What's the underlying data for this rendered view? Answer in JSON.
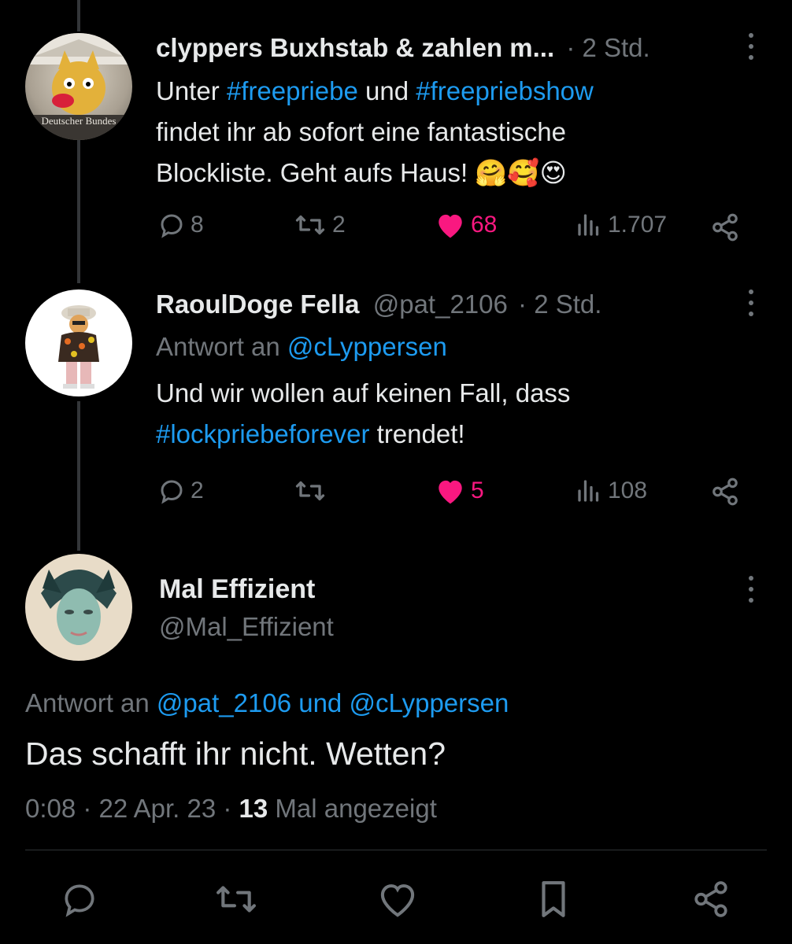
{
  "tweet1": {
    "display_name": "clyppers Buxhstab & zahlen m...",
    "time": "· 2 Std.",
    "text_line1_pre": "Unter ",
    "hashtag1": "#freepriebe",
    "text_line1_mid": " und ",
    "hashtag2": "#freepriebshow",
    "text_line2": "findet ihr ab sofort eine fantastische",
    "text_line3": "Blockliste. Geht aufs Haus! 🤗🥰😍",
    "avatar_caption": "Deutscher Bundes",
    "replies": "8",
    "retweets": "2",
    "likes": "68",
    "views": "1.707"
  },
  "tweet2": {
    "display_name": "RaoulDoge Fella",
    "handle": "@pat_2106",
    "time": "· 2 Std.",
    "reply_to_label": "Antwort an ",
    "reply_to_handle": "@cLyppersen",
    "text_line1": "Und wir wollen auf keinen Fall, dass",
    "hashtag": "#lockpriebeforever",
    "text_line2_post": " trendet!",
    "replies": "2",
    "retweets": "",
    "likes": "5",
    "views": "108"
  },
  "main_tweet": {
    "display_name": "Mal Effizient",
    "handle": "@Mal_Effizient",
    "reply_to_label": "Antwort an ",
    "reply_to_handle1": "@pat_2106",
    "reply_to_and": " und ",
    "reply_to_handle2": "@cLyppersen",
    "text": "Das schafft ihr nicht. Wetten?",
    "timestamp": "0:08 · 22 Apr. 23 · ",
    "views_count": "13",
    "views_label": " Mal angezeigt"
  },
  "colors": {
    "background": "#000000",
    "text": "#e7e9ea",
    "muted": "#71767b",
    "link": "#1d9bf0",
    "like": "#f91880"
  },
  "icons": {
    "reply": "reply-icon",
    "retweet": "retweet-icon",
    "like": "heart-icon",
    "views": "views-icon",
    "share": "share-icon",
    "bookmark": "bookmark-icon",
    "more": "more-icon"
  }
}
